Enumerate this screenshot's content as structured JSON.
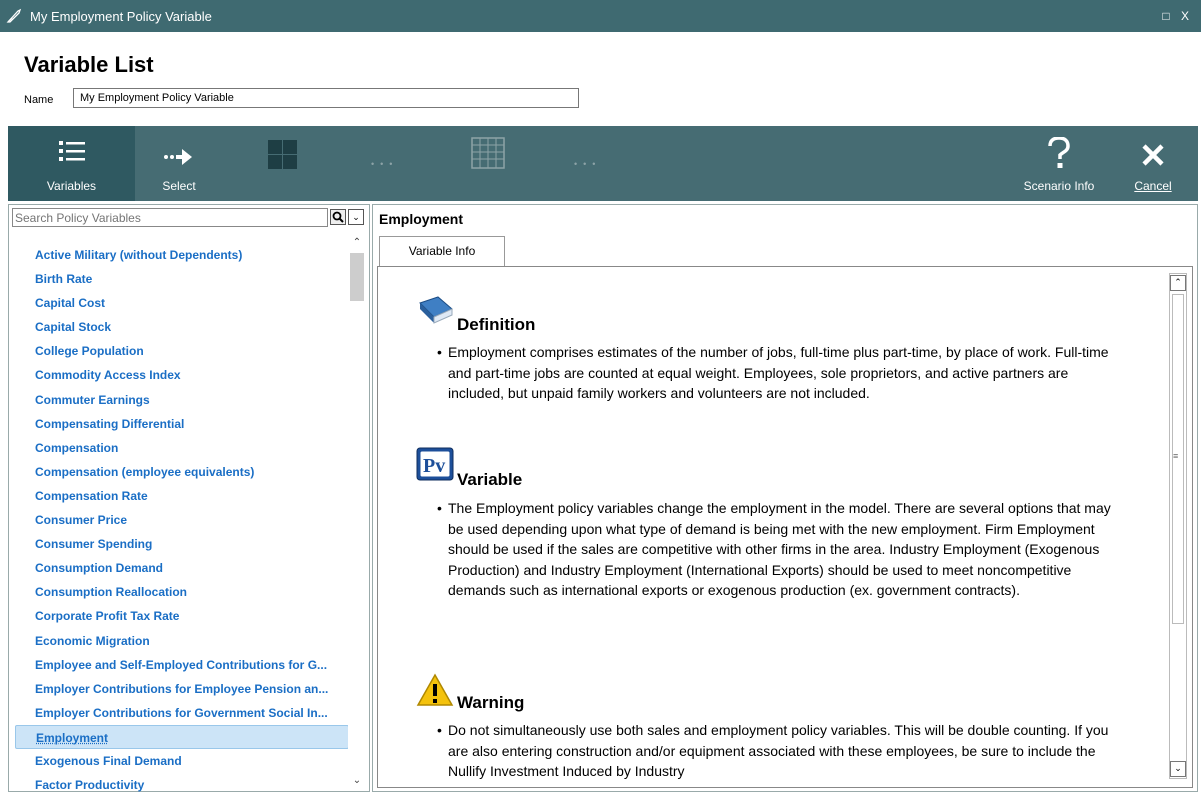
{
  "window": {
    "title": "My Employment Policy Variable",
    "buttons": "□ X"
  },
  "header": {
    "title": "Variable List",
    "name_label": "Name",
    "name_value": "My Employment Policy Variable"
  },
  "toolbar": {
    "variables_label": "Variables",
    "select_label": "Select",
    "scenario_info_label": "Scenario Info",
    "cancel_label": "Cancel",
    "dots": "•••"
  },
  "search": {
    "placeholder": "Search Policy Variables"
  },
  "variable_list": {
    "items": [
      "Active Military (without Dependents)",
      "Birth Rate",
      "Capital Cost",
      "Capital Stock",
      "College Population",
      "Commodity Access Index",
      "Commuter Earnings",
      "Compensating Differential",
      "Compensation",
      "Compensation (employee equivalents)",
      "Compensation Rate",
      "Consumer Price",
      "Consumer Spending",
      "Consumption Demand",
      "Consumption Reallocation",
      "Corporate Profit Tax Rate",
      "Economic Migration",
      "Employee and Self-Employed Contributions for G...",
      "Employer Contributions for Employee Pension an...",
      "Employer Contributions for Government Social In...",
      "Employment",
      "Exogenous Final Demand",
      "Factor Productivity"
    ],
    "selected": "Employment"
  },
  "detail": {
    "title": "Employment",
    "tab_label": "Variable Info",
    "definition": {
      "heading": "Definition",
      "body": "Employment comprises estimates of the number of jobs, full-time plus part-time, by place of work. Full-time and part-time jobs are counted at equal weight. Employees, sole proprietors, and active partners are included, but unpaid family workers and volunteers are not included."
    },
    "variable": {
      "icon_text": "Pv",
      "heading": "Variable",
      "body": "The Employment policy variables change the employment in the model. There are several options that may be used depending upon what type of demand is being met with the new employment. Firm Employment should be used if the sales are competitive with other firms in the area. Industry Employment (Exogenous Production) and Industry Employment (International Exports) should be used to meet noncompetitive demands such as international exports or exogenous production (ex. government contracts)."
    },
    "warning": {
      "heading": "Warning",
      "body": "Do not simultaneously use both sales and employment policy variables. This will be double counting. If you are also entering construction and/or equipment associated with these employees, be sure to include the Nullify Investment Induced by Industry"
    }
  },
  "colors": {
    "titlebar": "#3f6a71",
    "toolbar": "#466c73",
    "link": "#1a6ec5",
    "selected_row": "#cce4f7"
  }
}
